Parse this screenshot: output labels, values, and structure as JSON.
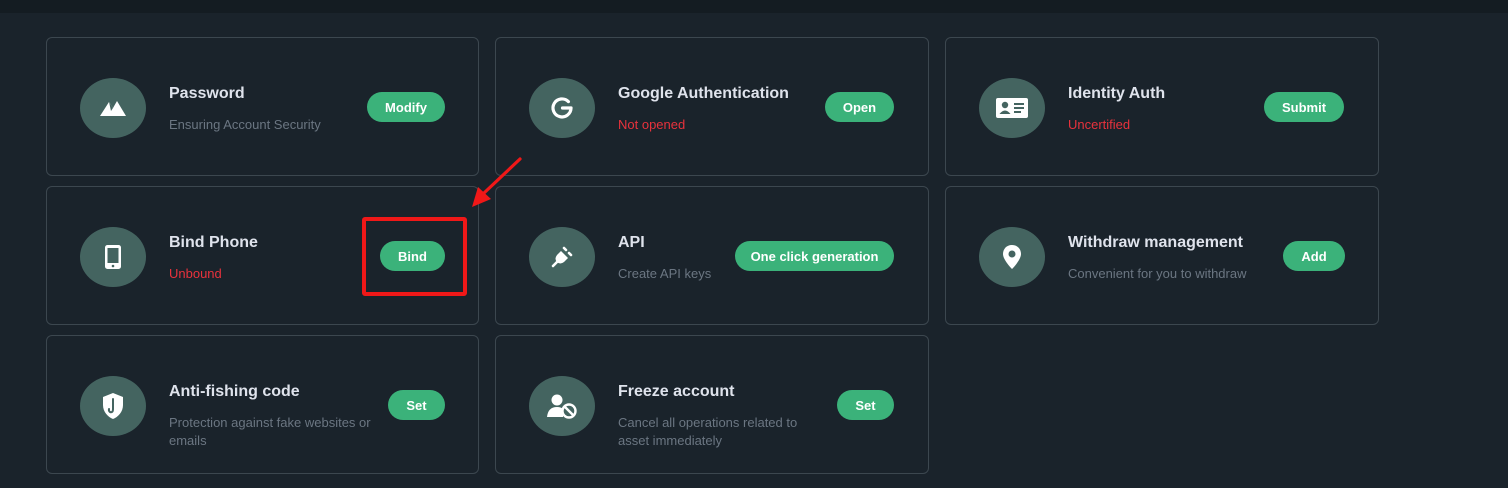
{
  "cards": [
    {
      "title": "Password",
      "desc": "Ensuring Account Security",
      "button": "Modify",
      "icon": "mountain-icon"
    },
    {
      "title": "Google Authentication",
      "desc": "Not opened",
      "button": "Open",
      "icon": "google-icon"
    },
    {
      "title": "Identity Auth",
      "desc": "Uncertified",
      "button": "Submit",
      "icon": "id-card-icon"
    },
    {
      "title": "Bind Phone",
      "desc": "Unbound",
      "button": "Bind",
      "icon": "phone-icon"
    },
    {
      "title": "API",
      "desc": "Create API keys",
      "button": "One click generation",
      "icon": "plug-icon"
    },
    {
      "title": "Withdraw management",
      "desc": "Convenient for you to withdraw",
      "button": "Add",
      "icon": "location-pin-icon"
    },
    {
      "title": "Anti-fishing code",
      "desc": "Protection against fake websites or emails",
      "button": "Set",
      "icon": "shield-hook-icon"
    },
    {
      "title": "Freeze account",
      "desc": "Cancel all operations related to asset immediately",
      "button": "Set",
      "icon": "user-block-icon"
    }
  ],
  "colors": {
    "background": "#1a232b",
    "card_border": "#3c474f",
    "icon_circle": "#446460",
    "button_green": "#3bb27a",
    "status_red": "#e8323c",
    "annotation_red": "#f01818"
  }
}
